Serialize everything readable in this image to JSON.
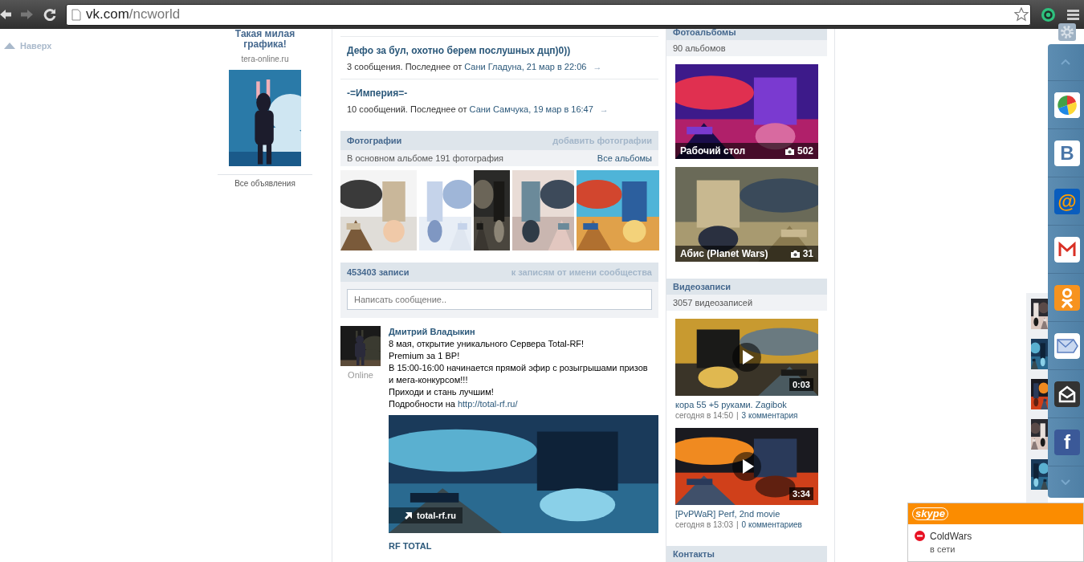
{
  "browser": {
    "url_host": "vk.com",
    "url_path": "/ncworld"
  },
  "scroll_up": {
    "label": "Наверх"
  },
  "ad": {
    "title": "Такая милая графика!",
    "domain": "tera-online.ru",
    "all_ads": "Все объявления"
  },
  "topics": [
    {
      "title": "Дефо за бул, охотно берем послушных дцп)0))",
      "summary": "3 сообщения. Последнее от",
      "last_post": "Сани Гладуна, 21 мар в 22:06",
      "arrow": "→"
    },
    {
      "title": "-=Империя=-",
      "summary": "10 сообщений. Последнее от",
      "last_post": "Сани Самчука, 19 мар в 16:47",
      "arrow": "→"
    }
  ],
  "photos": {
    "title": "Фотографии",
    "action": "добавить фотографии",
    "summary": "В основном альбоме 191 фотография",
    "all_albums": "Все альбомы"
  },
  "wall": {
    "title": "453403 записи",
    "action": "к записям от имени сообщества",
    "composer": {
      "placeholder": "Написать сообщение.."
    },
    "post": {
      "author": "Дмитрий Владыкин",
      "status": "Online",
      "lines": [
        "8 мая, открытие уникального Сервера Total-RF!",
        "Premium за 1 ВР!",
        "В 15:00-16:00 начинается прямой эфир с розыгрышами призов",
        "и мега-конкурсом!!!",
        "Приходи и стань лучшим!"
      ],
      "more_label": "Подробности на",
      "more_link": "http://total-rf.ru/",
      "attachment": {
        "kind": "picture",
        "link": "total-rf.ru"
      },
      "title": "RF TOTAL"
    }
  },
  "albums": {
    "title": "Фотоальбомы",
    "summary": "90 альбомов",
    "items": [
      {
        "title": "Рабочий стол",
        "count": "502"
      },
      {
        "title": "Абис (Planet Wars)",
        "count": "31"
      }
    ]
  },
  "videos": {
    "title": "Видеозаписи",
    "summary": "3057 видеозаписей",
    "items": [
      {
        "duration": "0:03",
        "title": "кора 55 +5 руками. Zagibok",
        "date": "сегодня в 14:50",
        "separator": "|",
        "comments": "3 комментария"
      },
      {
        "duration": "3:34",
        "title": "[PvPWaR] Perf, 2nd movie",
        "date": "сегодня в 13:03",
        "separator": "|",
        "comments": "0 комментариев"
      }
    ]
  },
  "contacts": {
    "title": "Контакты"
  },
  "social": {
    "items": [
      {
        "kind": "pie",
        "color": "#ffffff"
      },
      {
        "kind": "letter",
        "label": "В",
        "color": "#ffffff"
      },
      {
        "kind": "at-sign",
        "label": "@",
        "color": "#0a5dbd"
      },
      {
        "kind": "mail",
        "color": "#ffffff"
      },
      {
        "kind": "person",
        "color": "#f7931e"
      },
      {
        "kind": "envelope",
        "color": "#ffffff"
      },
      {
        "kind": "open-envelope",
        "color": "#333333"
      },
      {
        "kind": "light-letter",
        "label": "f",
        "color": "#3b5998"
      }
    ]
  },
  "skype": {
    "logo": "skype",
    "contact": {
      "name": "ColdWars",
      "busy": true,
      "status": "в сети"
    }
  }
}
